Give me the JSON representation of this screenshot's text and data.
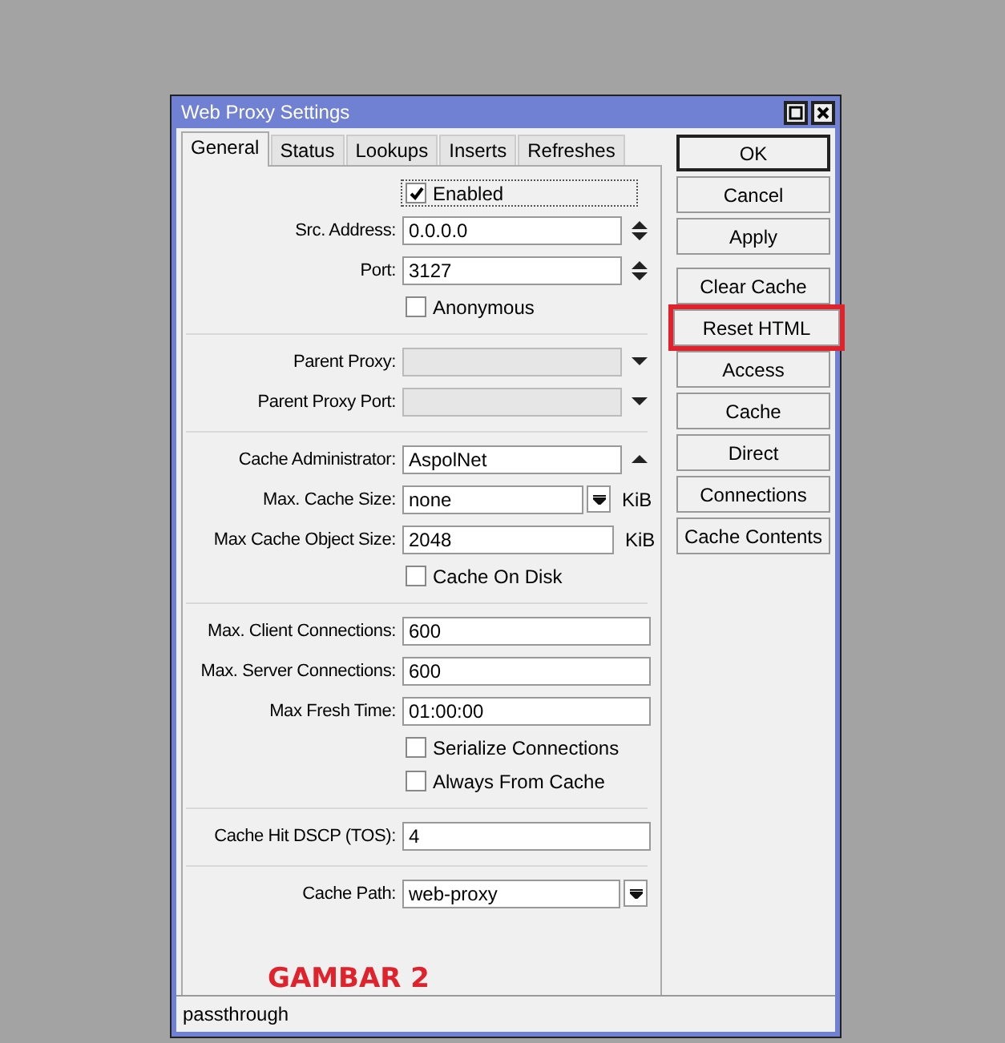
{
  "window": {
    "title": "Web Proxy Settings"
  },
  "tabs": [
    {
      "label": "General",
      "selected": true
    },
    {
      "label": "Status",
      "selected": false
    },
    {
      "label": "Lookups",
      "selected": false
    },
    {
      "label": "Inserts",
      "selected": false
    },
    {
      "label": "Refreshes",
      "selected": false
    }
  ],
  "sections": [
    {
      "rows": [
        {
          "kind": "checkbox",
          "label": "Enabled",
          "checked": true,
          "focused": true
        },
        {
          "kind": "spinner",
          "label": "Src. Address:",
          "value": "0.0.0.0",
          "disabled": false
        },
        {
          "kind": "spinner",
          "label": "Port:",
          "value": "3127",
          "disabled": false
        },
        {
          "kind": "checkbox",
          "label": "Anonymous",
          "checked": false,
          "focused": false
        }
      ]
    },
    {
      "rows": [
        {
          "kind": "downfield",
          "label": "Parent Proxy:",
          "disabled": true
        },
        {
          "kind": "downfield",
          "label": "Parent Proxy Port:",
          "disabled": true
        }
      ]
    },
    {
      "rows": [
        {
          "kind": "upfield",
          "label": "Cache Administrator:",
          "value": "AspolNet",
          "disabled": false
        },
        {
          "kind": "dropdown",
          "label": "Max. Cache Size:",
          "value": "none",
          "disabled": false,
          "unit": "KiB"
        },
        {
          "kind": "field",
          "label": "Max Cache Object Size:",
          "value": "2048",
          "disabled": false,
          "unit": "KiB"
        },
        {
          "kind": "checkbox",
          "label": "Cache On Disk",
          "checked": false,
          "focused": false
        }
      ]
    },
    {
      "rows": [
        {
          "kind": "field",
          "label": "Max. Client Connections:",
          "value": "600",
          "disabled": false
        },
        {
          "kind": "field",
          "label": "Max. Server Connections:",
          "value": "600",
          "disabled": false
        },
        {
          "kind": "field",
          "label": "Max Fresh Time:",
          "value": "01:00:00",
          "disabled": false
        },
        {
          "kind": "checkbox",
          "label": "Serialize Connections",
          "checked": false,
          "focused": false
        },
        {
          "kind": "checkbox",
          "label": "Always From Cache",
          "checked": false,
          "focused": false
        }
      ]
    },
    {
      "rows": [
        {
          "kind": "field",
          "label": "Cache Hit DSCP (TOS):",
          "value": "4",
          "disabled": false
        }
      ]
    },
    {
      "rows": [
        {
          "kind": "dropdown",
          "label": "Cache Path:",
          "value": "web-proxy",
          "disabled": false
        }
      ]
    }
  ],
  "annotation": "GAMBAR 2",
  "button_groups": [
    [
      {
        "label": "OK",
        "default": true,
        "highlighted": false
      },
      {
        "label": "Cancel",
        "default": false,
        "highlighted": false
      },
      {
        "label": "Apply",
        "default": false,
        "highlighted": false
      }
    ],
    [
      {
        "label": "Clear Cache",
        "default": false,
        "highlighted": false
      },
      {
        "label": "Reset HTML",
        "default": false,
        "highlighted": true
      },
      {
        "label": "Access",
        "default": false,
        "highlighted": false
      },
      {
        "label": "Cache",
        "default": false,
        "highlighted": false
      },
      {
        "label": "Direct",
        "default": false,
        "highlighted": false
      },
      {
        "label": "Connections",
        "default": false,
        "highlighted": false
      },
      {
        "label": "Cache Contents",
        "default": false,
        "highlighted": false
      }
    ]
  ],
  "status_bar": "passthrough"
}
